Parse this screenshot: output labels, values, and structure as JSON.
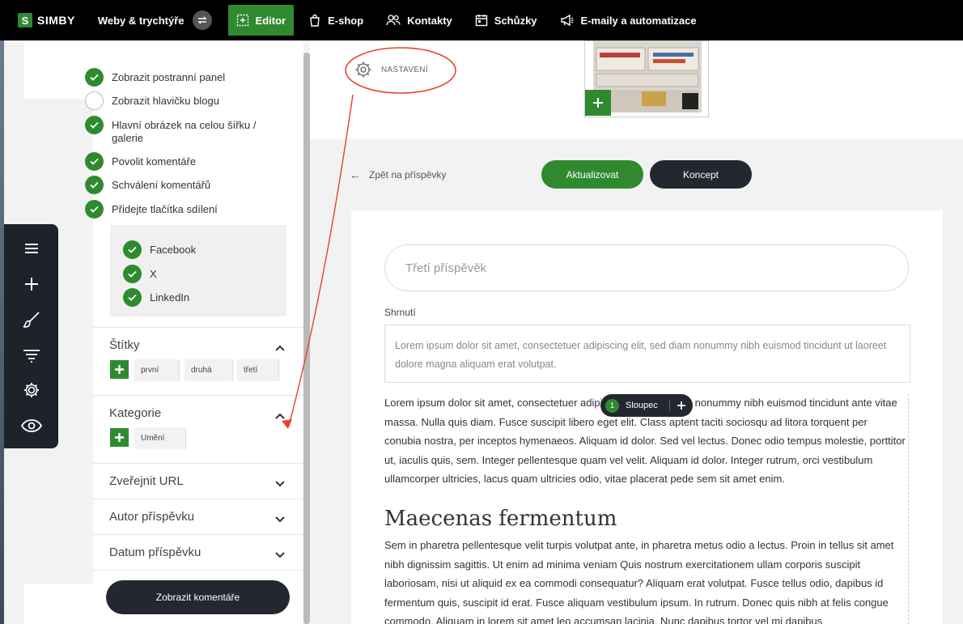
{
  "nav": {
    "brand": "SIMBY",
    "site": "Weby & trychtýře",
    "items": [
      {
        "label": "Editor",
        "icon": "editor-icon",
        "active": true
      },
      {
        "label": "E-shop",
        "icon": "shopping-bag-icon"
      },
      {
        "label": "Kontakty",
        "icon": "contacts-icon"
      },
      {
        "label": "Schůzky",
        "icon": "calendar-icon"
      },
      {
        "label": "E-maily a automatizace",
        "icon": "megaphone-icon"
      }
    ]
  },
  "tools": [
    "menu-icon",
    "add-icon",
    "brush-icon",
    "filter-icon",
    "gear-icon",
    "eye-icon"
  ],
  "sidebar": {
    "options": [
      {
        "label": "Zobrazit postranní panel",
        "checked": true
      },
      {
        "label": "Zobrazit hlavičku blogu",
        "checked": false
      },
      {
        "label": "Hlavní obrázek na celou šířku / galerie",
        "checked": true
      },
      {
        "label": "Povolit komentáře",
        "checked": true
      },
      {
        "label": "Schválení komentářů",
        "checked": true
      },
      {
        "label": "Přidejte tlačítka sdílení",
        "checked": true
      }
    ],
    "share": [
      {
        "label": "Facebook",
        "checked": true
      },
      {
        "label": "X",
        "checked": true
      },
      {
        "label": "LinkedIn",
        "checked": true
      }
    ],
    "tags": {
      "title": "Štítky",
      "items": [
        "první",
        "druhá",
        "třetí"
      ]
    },
    "categories": {
      "title": "Kategorie",
      "items": [
        "Umění"
      ]
    },
    "sections": [
      "Zveřejnit URL",
      "Autor příspěvku",
      "Datum příspěvku"
    ],
    "show_comments": "Zobrazit komentáře"
  },
  "main": {
    "settings_label": "NASTAVENÍ",
    "back": "Zpět na příspěvky",
    "update": "Aktualizovat",
    "draft": "Koncept",
    "title_placeholder": "Třetí příspěvěk",
    "summary_label": "Shrnutí",
    "summary_text": "Lorem ipsum dolor sit amet, consectetuer adipiscing elit, sed diam nonummy nibh euismod tincidunt ut laoreet dolore magna aliquam erat volutpat.",
    "column_number": "1",
    "column_label": "Sloupec",
    "para1": "Lorem ipsum dolor sit amet, consectetuer adipiscing elit, sed diam nonummy nibh euismod tincidunt ante vitae massa. Nulla quis diam. Fusce suscipit libero eget elit. Class aptent taciti sociosqu ad litora torquent per conubia nostra, per inceptos hymenaeos. Aliquam id dolor. Sed vel lectus. Donec odio tempus molestie, porttitor ut, iaculis quis, sem. Integer pellentesque quam vel velit. Aliquam id dolor. Integer rutrum, orci vestibulum ullamcorper ultricies, lacus quam ultricies odio, vitae placerat pede sem sit amet enim.",
    "heading": "Maecenas fermentum",
    "para2": "Sem in pharetra pellentesque velit turpis volutpat ante, in pharetra metus odio a lectus. Proin in tellus sit amet nibh dignissim sagittis. Ut enim ad minima veniam Quis nostrum exercitationem ullam corporis suscipit laboriosam, nisi ut aliquid ex ea commodi consequatur? Aliquam erat volutpat. Fusce tellus odio, dapibus id fermentum quis, suscipit id erat. Fusce aliquam vestibulum ipsum. In rutrum. Donec quis nibh at felis congue commodo. Aliquam in lorem sit amet leo accumsan lacinia. Nunc dapibus tortor vel mi dapibus"
  },
  "colors": {
    "accent": "#2f8a2f",
    "dark": "#23272f",
    "annotation": "#e8432a"
  }
}
